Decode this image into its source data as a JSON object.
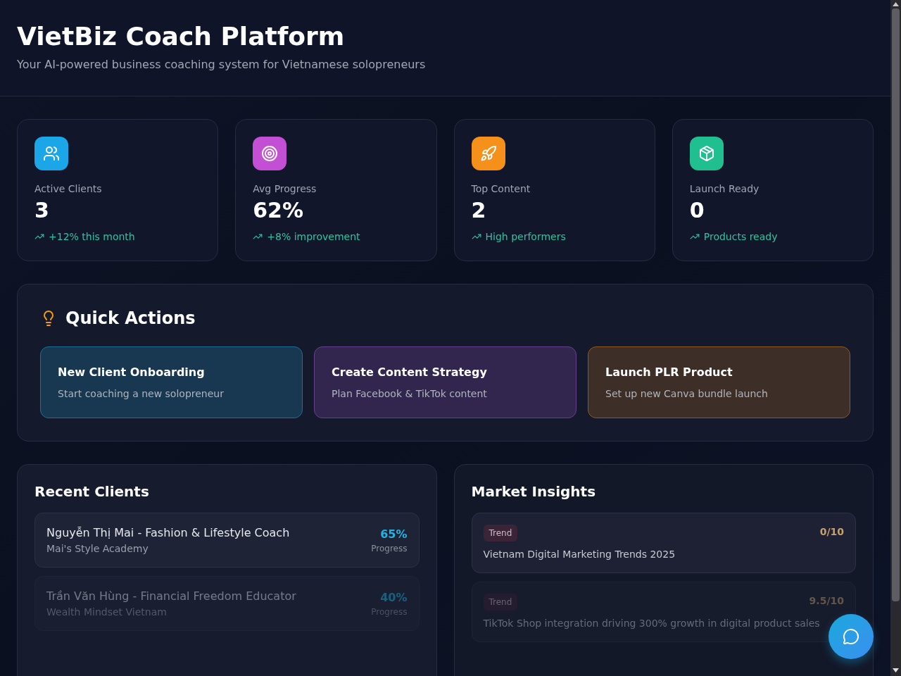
{
  "header": {
    "title": "VietBiz Coach Platform",
    "subtitle": "Your AI-powered business coaching system for Vietnamese solopreneurs"
  },
  "stats": [
    {
      "label": "Active Clients",
      "value": "3",
      "trend": "+12% this month",
      "color": "#1ba6e8"
    },
    {
      "label": "Avg Progress",
      "value": "62%",
      "trend": "+8% improvement",
      "color": "#c24fd4"
    },
    {
      "label": "Top Content",
      "value": "2",
      "trend": "High performers",
      "color": "#f5901a"
    },
    {
      "label": "Launch Ready",
      "value": "0",
      "trend": "Products ready",
      "color": "#20bf90"
    }
  ],
  "quick_actions": {
    "title": "Quick Actions",
    "items": [
      {
        "title": "New Client Onboarding",
        "description": "Start coaching a new solopreneur",
        "color": "#1f6f96"
      },
      {
        "title": "Create Content Strategy",
        "description": "Plan Facebook & TikTok content",
        "color": "#6b3f8f"
      },
      {
        "title": "Launch PLR Product",
        "description": "Set up new Canva bundle launch",
        "color": "#8a5a22"
      }
    ]
  },
  "recent_clients": {
    "title": "Recent Clients",
    "clients": [
      {
        "name": "Nguyễn Thị Mai - Fashion & Lifestyle Coach",
        "business": "Mai's Style Academy",
        "progress": "65%",
        "progress_label": "Progress",
        "faded": false
      },
      {
        "name": "Trần Văn Hùng - Financial Freedom Educator",
        "business": "Wealth Mindset Vietnam",
        "progress": "40%",
        "progress_label": "Progress",
        "faded": true
      }
    ]
  },
  "market_insights": {
    "title": "Market Insights",
    "items": [
      {
        "tag": "Trend",
        "score": "0/10",
        "text": "Vietnam Digital Marketing Trends 2025",
        "faded": false
      },
      {
        "tag": "Trend",
        "score": "9.5/10",
        "text": "TikTok Shop integration driving 300% growth in digital product sales",
        "faded": true
      }
    ]
  }
}
